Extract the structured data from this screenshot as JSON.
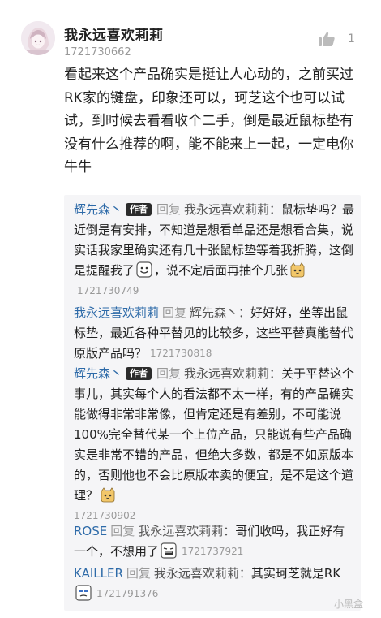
{
  "comment": {
    "username": "我永远喜欢莉莉",
    "uid": "1721730662",
    "likes": "1",
    "text": "看起来这个产品确实是挺让人心动的，之前买过RK家的键盘，印象还可以，珂芝这个也可以试试，到时候去看看收个二手，倒是最近鼠标垫有没有什么推荐的啊，能不能来上一起，一定电你牛牛"
  },
  "replies": [
    {
      "name": "辉先森丶",
      "badge": "作者",
      "verb": "回复",
      "target": "我永远喜欢莉莉：",
      "text": "鼠标垫吗？最近倒是有安排，不知道是想看单品还是想看合集，说实话我家里确实还有几十张鼠标垫等着我折腾，这倒是提醒我了",
      "text2": "，说不定后面再抽个几张",
      "time": "1721730749"
    },
    {
      "name": "我永远喜欢莉莉",
      "verb": "回复",
      "target": "辉先森丶：",
      "text": "好好好，坐等出鼠标垫，最近各种平替见的比较多，这些平替真能替代原版产品吗？",
      "time": "1721730818"
    },
    {
      "name": "辉先森丶",
      "badge": "作者",
      "verb": "回复",
      "target": "我永远喜欢莉莉：",
      "text": "关于平替这个事儿，其实每个人的看法都不太一样，有的产品确实能做得非常非常像，但肯定还是有差别，不可能说100%完全替代某一个上位产品，只能说有些产品确实是非常不错的产品，但绝大多数，都是不如原版本的，否则他也不会比原版本卖的便宜，是不是这个道理？",
      "time": "1721730902"
    },
    {
      "name": "ROSE",
      "verb": "回复",
      "target": "我永远喜欢莉莉：",
      "text": "哥们收吗，我正好有一个，不想用了",
      "time": "1721737921"
    },
    {
      "name": "KAILLER",
      "verb": "回复",
      "target": "我永远喜欢莉莉：",
      "text": "其实珂芝就是RK",
      "time": "1721791376"
    }
  ],
  "watermark": "小黑盒",
  "icons": {
    "like": "thumbs-up-icon",
    "avatar": "anime-avatar",
    "emoji": "sticker-emoji-icon"
  },
  "colors": {
    "name_link": "#2d6aa8",
    "muted": "#999999",
    "reply_bg": "#f5f5f7",
    "badge_bg": "#2b2b2b"
  }
}
